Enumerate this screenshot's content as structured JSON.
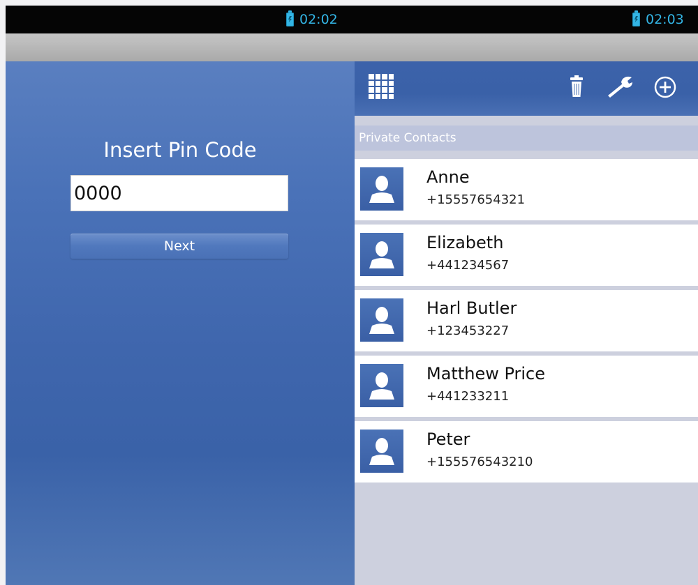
{
  "status_bar": {
    "left_time": "02:02",
    "right_time": "02:03",
    "clock_color": "#33b5e5"
  },
  "pin_screen": {
    "title": "Insert Pin Code",
    "pin_value": "0000",
    "next_label": "Next",
    "background_color": "#4a72b8"
  },
  "contacts_screen": {
    "toolbar_icons": [
      "grid-icon",
      "trash-icon",
      "wrench-icon",
      "add-icon"
    ],
    "section_title": "Private Contacts",
    "accent_color": "#3c62aa",
    "contacts": [
      {
        "name": "Anne",
        "phone": "+15557654321"
      },
      {
        "name": "Elizabeth",
        "phone": "+441234567"
      },
      {
        "name": "Harl Butler",
        "phone": "+123453227"
      },
      {
        "name": "Matthew Price",
        "phone": "+441233211"
      },
      {
        "name": "Peter",
        "phone": "+155576543210"
      }
    ]
  }
}
